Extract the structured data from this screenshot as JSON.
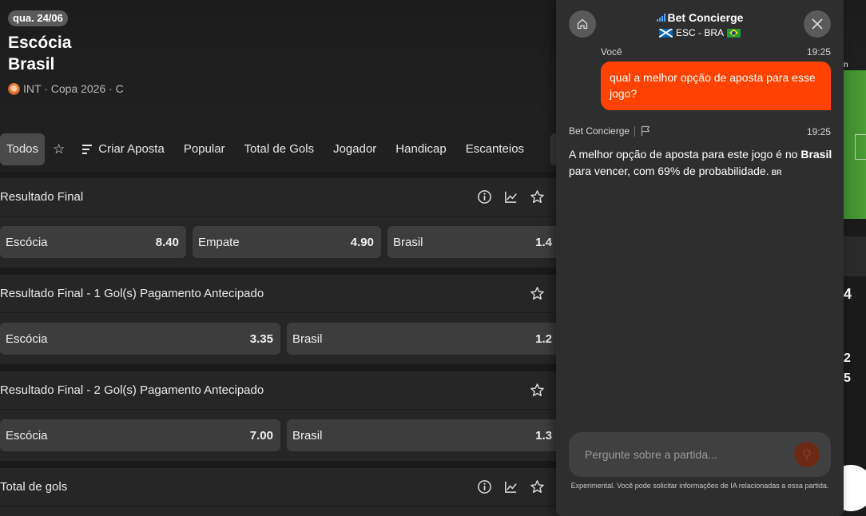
{
  "match": {
    "date": "qua. 24/06",
    "team1": "Escócia",
    "team2": "Brasil",
    "league": "INT · Copa 2026 · C"
  },
  "tabs": {
    "todos": "Todos",
    "criar_aposta": "Criar Aposta",
    "popular": "Popular",
    "total_gols": "Total de Gols",
    "jogador": "Jogador",
    "handicap": "Handicap",
    "escanteios": "Escanteios"
  },
  "markets": [
    {
      "title": "Resultado Final",
      "odds": [
        {
          "label": "Escócia",
          "value": "8.40"
        },
        {
          "label": "Empate",
          "value": "4.90"
        },
        {
          "label": "Brasil",
          "value": "1.4"
        }
      ]
    },
    {
      "title": "Resultado Final - 1 Gol(s) Pagamento Antecipado",
      "odds": [
        {
          "label": "Escócia",
          "value": "3.35"
        },
        {
          "label": "Brasil",
          "value": "1.2"
        }
      ]
    },
    {
      "title": "Resultado Final - 2 Gol(s) Pagamento Antecipado",
      "odds": [
        {
          "label": "Escócia",
          "value": "7.00"
        },
        {
          "label": "Brasil",
          "value": "1.3"
        }
      ]
    },
    {
      "title": "Total de gols"
    }
  ],
  "edge": {
    "t1": "n",
    "t2": "4",
    "t3": "2",
    "t4": "5"
  },
  "chat": {
    "title": "Bet Concierge",
    "subtitle": "ESC - BRA",
    "user_label": "Você",
    "user_time": "19:25",
    "user_message": "qual a melhor opção de aposta para esse jogo?",
    "bot_label": "Bet Concierge",
    "bot_time": "19:25",
    "bot_message_pre": "A melhor opção de aposta para este jogo é no ",
    "bot_message_bold": "Brasil",
    "bot_message_post": " para vencer, com 69% de probabilidade.",
    "bot_tag": "BR",
    "input_placeholder": "Pergunte sobre a partida...",
    "disclaimer": "Experimental. Você pode solicitar informações de IA relacionadas a essa partida."
  },
  "colors": {
    "accent": "#ff4200",
    "panel": "#2e2e2e",
    "button": "#3d3d3d"
  }
}
